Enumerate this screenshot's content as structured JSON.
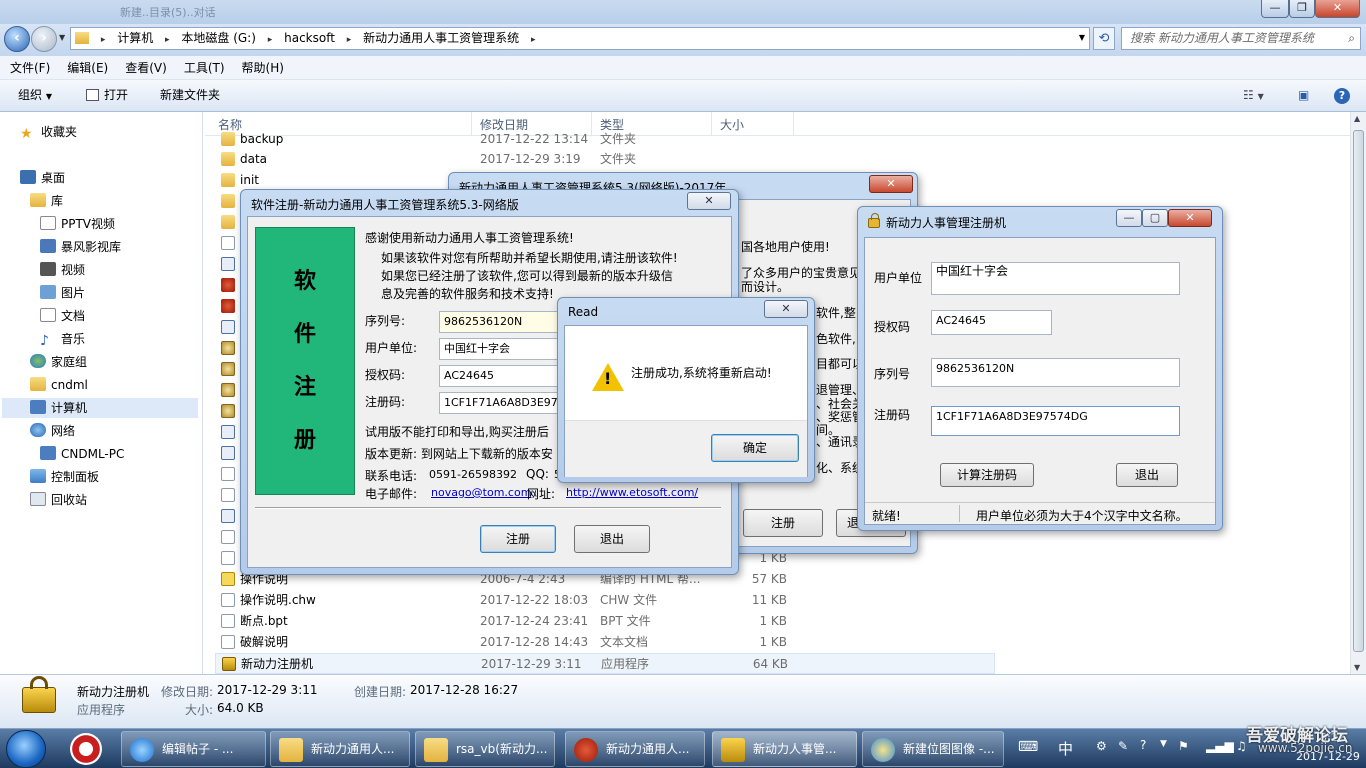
{
  "explorer": {
    "window_title_ghost": "新建..目录(5)..对话",
    "caption_buttons": {
      "minimize": "—",
      "maximize": "❐",
      "close": "✕"
    },
    "breadcrumbs": [
      "计算机",
      "本地磁盘 (G:)",
      "hacksoft",
      "新动力通用人事工资管理系统"
    ],
    "search_placeholder": "搜索 新动力通用人事工资管理系统",
    "menu": [
      "文件(F)",
      "编辑(E)",
      "查看(V)",
      "工具(T)",
      "帮助(H)"
    ],
    "toolbar": {
      "organize": "组织",
      "open": "打开",
      "new_folder": "新建文件夹"
    },
    "sidebar": [
      {
        "label": "收藏夹",
        "icon": "star-icon"
      },
      {
        "label": "桌面",
        "icon": "desktop-icon"
      },
      {
        "label": "库",
        "icon": "library-icon"
      },
      {
        "label": "PPTV视频",
        "icon": "video-library-icon"
      },
      {
        "label": "暴风影视库",
        "icon": "video-library-icon"
      },
      {
        "label": "视频",
        "icon": "video-icon"
      },
      {
        "label": "图片",
        "icon": "picture-icon"
      },
      {
        "label": "文档",
        "icon": "document-icon"
      },
      {
        "label": "音乐",
        "icon": "music-icon"
      },
      {
        "label": "家庭组",
        "icon": "homegroup-icon"
      },
      {
        "label": "cndml",
        "icon": "user-folder-icon"
      },
      {
        "label": "计算机",
        "icon": "computer-icon"
      },
      {
        "label": "网络",
        "icon": "network-icon"
      },
      {
        "label": "CNDML-PC",
        "icon": "pc-icon"
      },
      {
        "label": "控制面板",
        "icon": "control-panel-icon"
      },
      {
        "label": "回收站",
        "icon": "recycle-bin-icon"
      }
    ],
    "columns": {
      "name": "名称",
      "date": "修改日期",
      "type": "类型",
      "size": "大小"
    },
    "files_top": [
      {
        "name": "backup",
        "date": "2017-12-22 13:14",
        "type": "文件夹",
        "size": ""
      },
      {
        "name": "data",
        "date": "2017-12-29 3:19",
        "type": "文件夹",
        "size": ""
      },
      {
        "name": "init",
        "date": "",
        "type": "",
        "size": ""
      }
    ],
    "files_bottom": [
      {
        "name": "",
        "date": "",
        "type": "",
        "size": "1 KB"
      },
      {
        "name": "操作说明",
        "date": "2006-7-4 2:43",
        "type": "编译的 HTML 帮...",
        "size": "57 KB"
      },
      {
        "name": "操作说明.chw",
        "date": "2017-12-22 18:03",
        "type": "CHW 文件",
        "size": "11 KB"
      },
      {
        "name": "断点.bpt",
        "date": "2017-12-24 23:41",
        "type": "BPT 文件",
        "size": "1 KB"
      },
      {
        "name": "破解说明",
        "date": "2017-12-28 14:43",
        "type": "文本文档",
        "size": "1 KB"
      },
      {
        "name": "新动力注册机",
        "date": "2017-12-29 3:11",
        "type": "应用程序",
        "size": "64 KB"
      }
    ],
    "details": {
      "name": "新动力注册机",
      "modified_label": "修改日期:",
      "modified": "2017-12-29 3:11",
      "created_label": "创建日期:",
      "created": "2017-12-28 16:27",
      "kind": "应用程序",
      "size_label": "大小:",
      "size": "64.0 KB"
    }
  },
  "back_window": {
    "title": "新动力通用人事工资管理系统5.3(网络版)-2017年",
    "partial_lines": [
      "国各地用户使用!",
      "了众多用户的宝贵意见",
      "而设计。",
      "软件,整",
      "色软件,",
      "目都可以",
      "退管理、",
      "、社会关系",
      "、奖惩管",
      "间。",
      "、通讯录",
      "化、系统"
    ],
    "register_button": "注册",
    "next_button_partial": "退"
  },
  "reg_dialog": {
    "title": "软件注册-新动力通用人事工资管理系统5.3-网络版",
    "banner": [
      "软",
      "件",
      "注",
      "册"
    ],
    "intro": [
      "感谢使用新动力通用人事工资管理系统!",
      "如果该软件对您有所帮助并希望长期使用,请注册该软件!",
      "如果您已经注册了该软件,您可以得到最新的版本升级信",
      "息及完善的软件服务和技术支持!"
    ],
    "serial_label": "序列号:",
    "serial": "9862536120N",
    "unit_label": "用户单位:",
    "unit": "中国红十字会",
    "auth_label": "授权码:",
    "auth": "AC24645",
    "regcode_label": "注册码:",
    "regcode": "1CF1F71A6A8D3E9757",
    "trial_note": "试用版不能打印和导出,购买注册后",
    "update_note": "版本更新: 到网站上下载新的版本安",
    "phone_label": "联系电话:",
    "phone": "0591-26598392",
    "qq_label": "QQ:",
    "qq": "5",
    "email_label": "电子邮件:",
    "email": "novago@tom.com",
    "web_label": "网址:",
    "web": "http://www.etosoft.com/",
    "register_button": "注册",
    "exit_button": "退出"
  },
  "message_box": {
    "title": "Read",
    "message": "注册成功,系统将重新启动!",
    "ok_button": "确定"
  },
  "keygen": {
    "title": "新动力人事管理注册机",
    "unit_label": "用户单位",
    "unit": "中国红十字会",
    "auth_label": "授权码",
    "auth": "AC24645",
    "serial_label": "序列号",
    "serial": "9862536120N",
    "regcode_label": "注册码",
    "regcode": "1CF1F71A6A8D3E97574DG",
    "compute_button": "计算注册码",
    "exit_button": "退出",
    "status_ready": "就绪!",
    "status_hint": "用户单位必须为大于4个汉字中文名称。"
  },
  "taskbar": {
    "items": [
      {
        "label": "编辑帖子 - ...",
        "icon": "ie-icon"
      },
      {
        "label": "新动力通用人...",
        "icon": "folder-icon"
      },
      {
        "label": "rsa_vb(新动力...",
        "icon": "folder-icon"
      },
      {
        "label": "新动力通用人...",
        "icon": "app-red-icon"
      },
      {
        "label": "新动力人事管...",
        "icon": "lock-icon"
      },
      {
        "label": "新建位图图像 -...",
        "icon": "paint-icon"
      }
    ],
    "ime": "中",
    "time": "3:22",
    "date": "2017-12-29",
    "watermark": "吾爱破解论坛",
    "watermark_url": "www.52pojie.cn"
  }
}
